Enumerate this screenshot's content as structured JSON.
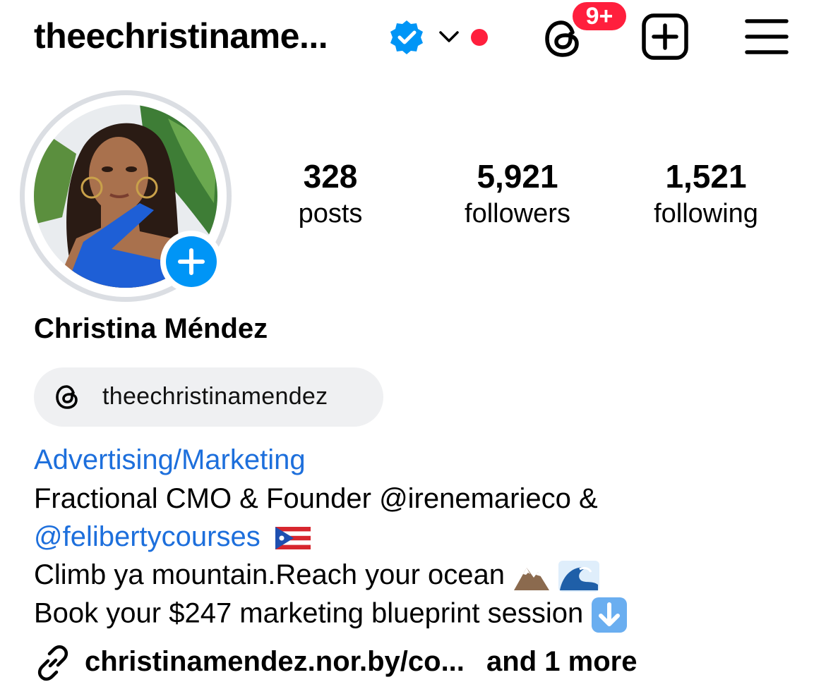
{
  "header": {
    "username": "theechristiname...",
    "notification_badge": "9+"
  },
  "profile": {
    "posts_count": "328",
    "posts_label": "posts",
    "followers_count": "5,921",
    "followers_label": "followers",
    "following_count": "1,521",
    "following_label": "following",
    "full_name": "Christina Méndez",
    "threads_handle": "theechristinamendez",
    "category": "Advertising/Marketing"
  },
  "bio": {
    "line1": "Fractional CMO & Founder @irenemarieco &",
    "line2_mention": "@felibertycourses",
    "line3": "Climb ya mountain.Reach your ocean",
    "line4": "Book your $247 marketing blueprint session"
  },
  "link": {
    "url": "christinamendez.nor.by/co...",
    "more": "and 1 more"
  },
  "colors": {
    "accent_blue": "#0095f6",
    "link_blue": "#1d6fdc",
    "badge_red": "#ff1f3d",
    "chip_bg": "#eff0f2"
  },
  "icons": [
    "verified-badge-icon",
    "chevron-down-icon",
    "threads-icon",
    "new-post-icon",
    "menu-icon",
    "add-story-icon",
    "link-icon",
    "puerto-rico-flag-icon",
    "mountain-icon",
    "wave-icon",
    "down-arrow-icon"
  ]
}
